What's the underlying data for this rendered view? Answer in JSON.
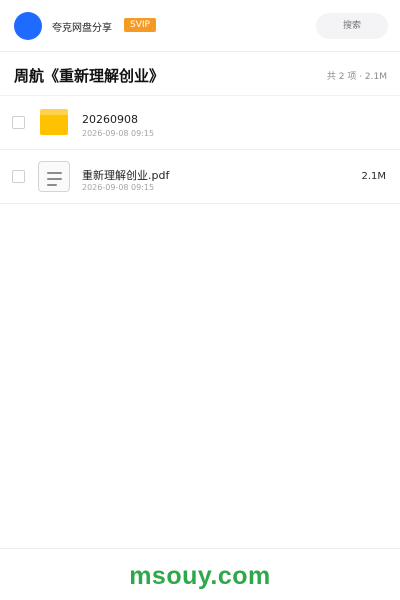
{
  "header": {
    "username": "夸克网盘分享",
    "badge": "SVIP",
    "search_placeholder": "搜索",
    "brand_color": "#1f6bff",
    "badge_color": "#f59a23"
  },
  "share": {
    "title": "周航《重新理解创业》",
    "summary": "共 2 项 · 2.1M"
  },
  "files": [
    {
      "name": "20260908",
      "date": "2026-09-08 09:15",
      "size": "",
      "icon": "folder-icon"
    },
    {
      "name": "重新理解创业.pdf",
      "date": "2026-09-08 09:15",
      "size": "2.1M",
      "icon": "document-icon"
    }
  ],
  "footer": {
    "watermark": "msouy.com",
    "watermark_color": "#2ea84a"
  }
}
